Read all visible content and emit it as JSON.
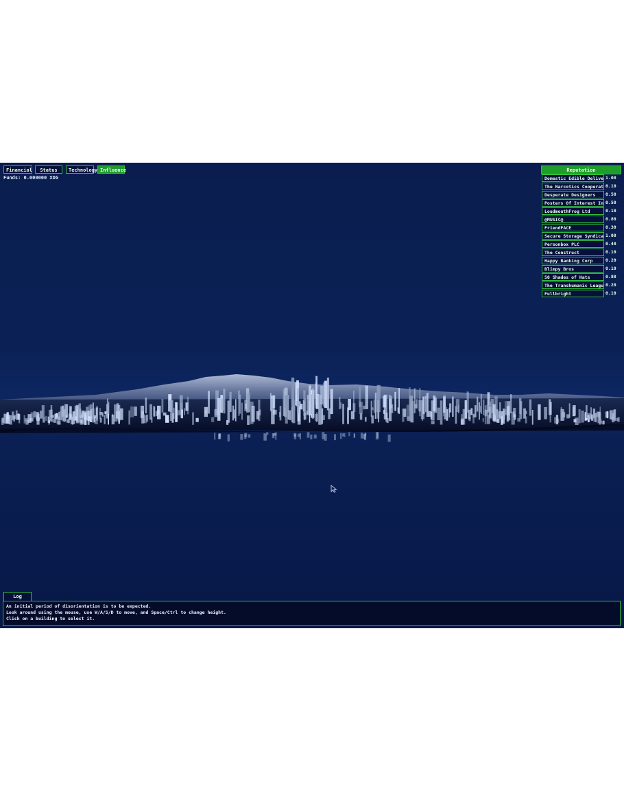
{
  "tabs": [
    {
      "label": "Financial",
      "active": false
    },
    {
      "label": "Status",
      "active": false
    },
    {
      "label": "Technology",
      "active": false
    },
    {
      "label": "Influence",
      "active": true
    }
  ],
  "funds": "Funds: 0.000000 XDG",
  "reputation": {
    "title": "Reputation",
    "rows": [
      {
        "name": "Domestic Edible Deliveries",
        "value": "1.00"
      },
      {
        "name": "The Narcotics Cooperative",
        "value": "0.10"
      },
      {
        "name": "Desperate Designers",
        "value": "0.50"
      },
      {
        "name": "Posters Of Interest Inc",
        "value": "0.50"
      },
      {
        "name": "LoudmouthFrog Ltd",
        "value": "0.10"
      },
      {
        "name": "@MUSIC@",
        "value": "0.80"
      },
      {
        "name": "FriendFACE",
        "value": "0.30"
      },
      {
        "name": "Secure Storage Syndicate",
        "value": "1.00"
      },
      {
        "name": "Personbox PLC",
        "value": "0.40"
      },
      {
        "name": "The Construct",
        "value": "0.10"
      },
      {
        "name": "Happy Banking Corp",
        "value": "0.20"
      },
      {
        "name": "Blimpy Bros",
        "value": "0.10"
      },
      {
        "name": "50 Shades of Hats",
        "value": "0.80"
      },
      {
        "name": "The Transhumanic League",
        "value": "0.20"
      },
      {
        "name": "Fullbright",
        "value": "0.10"
      }
    ]
  },
  "log": {
    "tab_label": "Log",
    "lines": [
      "An initial period of disorientation is to be expected.",
      "Look around using the mouse, use W/A/S/D to move, and Space/Ctrl to change height.",
      "Click on a building to select it."
    ]
  },
  "colors": {
    "accent": "#2fbf3a",
    "sky": "#0b2156",
    "panel": "#06103a"
  },
  "icons": {
    "cursor": "mouse-pointer-icon"
  }
}
